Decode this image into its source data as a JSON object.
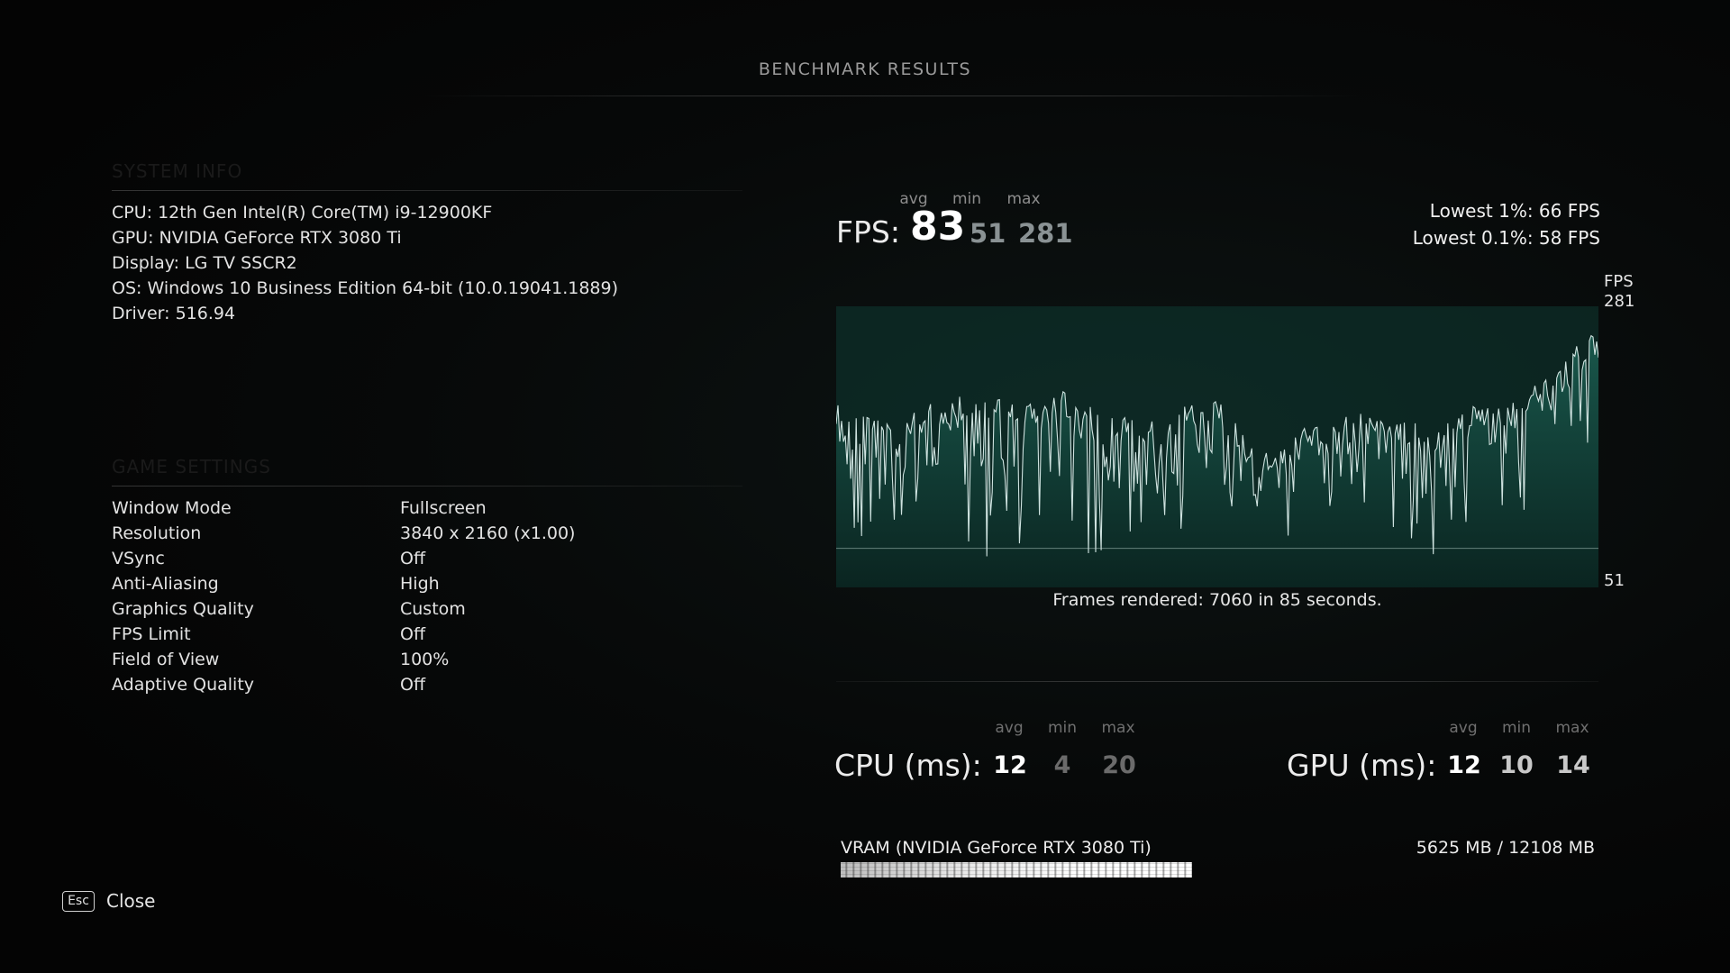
{
  "header": {
    "title": "BENCHMARK RESULTS"
  },
  "system_info": {
    "section_title": "SYSTEM INFO",
    "lines": [
      "CPU: 12th Gen Intel(R) Core(TM) i9-12900KF",
      "GPU: NVIDIA GeForce RTX 3080 Ti",
      "Display: LG TV SSCR2",
      "OS: Windows 10 Business Edition 64-bit (10.0.19041.1889)",
      "Driver: 516.94"
    ]
  },
  "game_settings": {
    "section_title": "GAME SETTINGS",
    "rows": [
      {
        "label": "Window Mode",
        "value": "Fullscreen"
      },
      {
        "label": "Resolution",
        "value": "3840 x 2160 (x1.00)"
      },
      {
        "label": "VSync",
        "value": "Off"
      },
      {
        "label": "Anti-Aliasing",
        "value": "High"
      },
      {
        "label": "Graphics Quality",
        "value": "Custom"
      },
      {
        "label": "FPS Limit",
        "value": "Off"
      },
      {
        "label": "Field of View",
        "value": "100%"
      },
      {
        "label": "Adaptive Quality",
        "value": "Off"
      }
    ]
  },
  "fps": {
    "label": "FPS:",
    "avg_caption": "avg",
    "min_caption": "min",
    "max_caption": "max",
    "avg": "83",
    "min": "51",
    "max": "281",
    "lowest_1": "Lowest 1%: 66 FPS",
    "lowest_01": "Lowest 0.1%: 58 FPS"
  },
  "chart_data": {
    "type": "line",
    "title": "",
    "ylabel": "FPS",
    "ymax_label": "281",
    "ymin_label": "51",
    "ylim": [
      51,
      281
    ],
    "reference_line": 83,
    "x_seconds": 85,
    "frames_caption": "Frames rendered: 7060 in 85 seconds.",
    "line_color": "#cfe3e0",
    "fill_color": "#0f3a33",
    "envelope_x": [
      0,
      0.03,
      0.06,
      0.1,
      0.14,
      0.18,
      0.22,
      0.26,
      0.3,
      0.34,
      0.38,
      0.42,
      0.46,
      0.5,
      0.53,
      0.56,
      0.59,
      0.62,
      0.66,
      0.7,
      0.74,
      0.78,
      0.82,
      0.86,
      0.9,
      0.94,
      0.97,
      1.0
    ],
    "envelope_fps": [
      205,
      200,
      190,
      195,
      205,
      210,
      208,
      200,
      212,
      198,
      190,
      192,
      200,
      205,
      185,
      160,
      170,
      185,
      190,
      195,
      190,
      182,
      195,
      205,
      210,
      225,
      248,
      270
    ],
    "dip_fps": [
      140,
      135,
      125,
      130,
      140,
      130,
      110,
      125,
      150,
      115,
      128,
      130,
      140,
      138,
      120,
      105,
      118,
      128,
      132,
      135,
      128,
      122,
      135,
      148,
      155,
      168,
      190,
      210
    ]
  },
  "cpu": {
    "label": "CPU (ms):",
    "avg_caption": "avg",
    "min_caption": "min",
    "max_caption": "max",
    "avg": "12",
    "min": "4",
    "max": "20"
  },
  "gpu": {
    "label": "GPU (ms):",
    "avg_caption": "avg",
    "min_caption": "min",
    "max_caption": "max",
    "avg": "12",
    "min": "10",
    "max": "14"
  },
  "vram": {
    "label": "VRAM (NVIDIA GeForce RTX 3080 Ti)",
    "value": "5625 MB / 12108 MB",
    "used_mb": 5625,
    "total_mb": 12108
  },
  "footer": {
    "key": "Esc",
    "label": "Close"
  }
}
